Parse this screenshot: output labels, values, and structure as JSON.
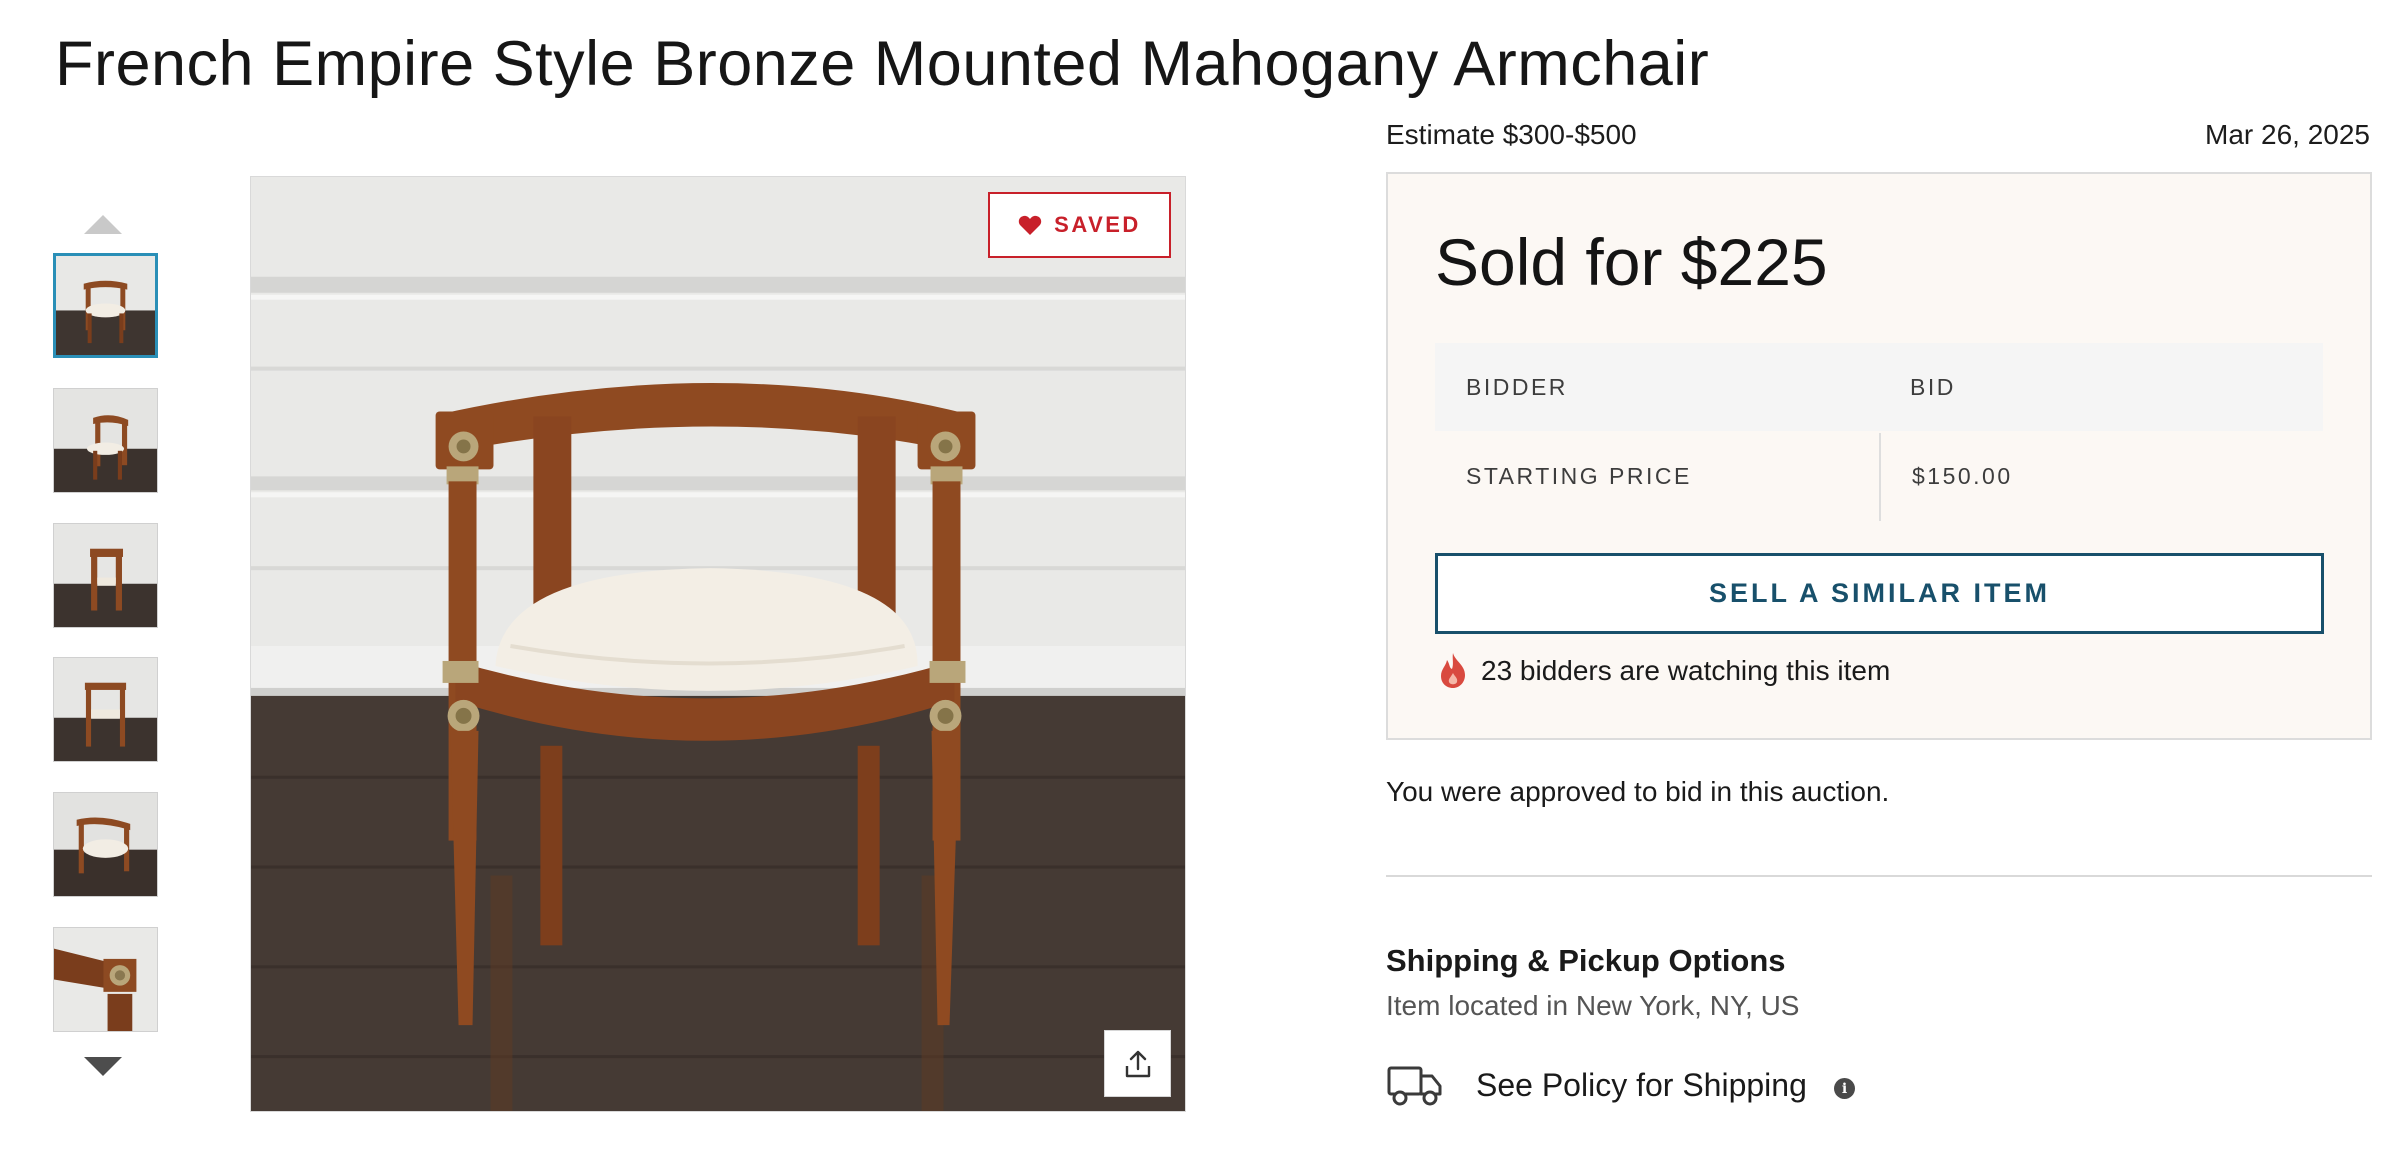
{
  "lot": {
    "title": "French Empire Style Bronze Mounted Mahogany Armchair",
    "estimate": "Estimate $300-$500",
    "date": "Mar 26, 2025"
  },
  "gallery": {
    "thumbnail_count": 6,
    "active_index": 0,
    "saved_label": "SAVED"
  },
  "bidding": {
    "sold_text": "Sold for $225",
    "table_headers": [
      "BIDDER",
      "BID"
    ],
    "rows": [
      {
        "label": "STARTING PRICE",
        "value": "$150.00"
      }
    ],
    "sell_button": "SELL A SIMILAR ITEM",
    "watchers_text": "23 bidders are watching this item"
  },
  "approval_text": "You were approved to bid in this auction.",
  "shipping": {
    "title": "Shipping & Pickup Options",
    "location": "Item located in New York, NY, US",
    "policy_link": "See Policy for Shipping",
    "info_glyph": "i"
  },
  "colors": {
    "saved_red": "#c8202a",
    "accent_blue": "#18506b",
    "active_thumb_border": "#2a8fb7",
    "panel_bg": "#fcf8f4"
  },
  "icons": [
    "heart-icon",
    "share-icon",
    "flame-icon",
    "truck-icon",
    "info-icon",
    "chevron-up-icon",
    "chevron-down-icon"
  ]
}
